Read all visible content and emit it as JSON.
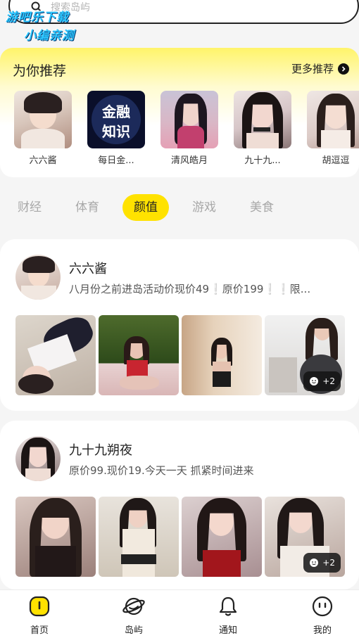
{
  "search": {
    "placeholder": "搜索岛屿"
  },
  "watermark": {
    "line1": "游吧乐下载",
    "line2": "小编亲测"
  },
  "recommend": {
    "title": "为你推荐",
    "more_label": "更多推荐",
    "items": [
      {
        "name": "六六酱"
      },
      {
        "name": "每日金...",
        "logo_text_1": "金融",
        "logo_text_2": "知识"
      },
      {
        "name": "清风皓月"
      },
      {
        "name": "九十九..."
      },
      {
        "name": "胡逗逗"
      }
    ]
  },
  "tabs": [
    {
      "label": "财经"
    },
    {
      "label": "体育"
    },
    {
      "label": "颜值",
      "active": true
    },
    {
      "label": "游戏"
    },
    {
      "label": "美食"
    }
  ],
  "posts": [
    {
      "author": "六六酱",
      "desc_part1": "八月份之前进岛活动价现价49",
      "desc_bang1": "❕",
      "desc_part2": "原价199",
      "desc_bang2": "❕❕",
      "desc_part3": "限...",
      "more_count": "+2"
    },
    {
      "author": "九十九朔夜",
      "desc": "原价99.现价19.今天一天 抓紧时间进来",
      "more_count": "+2"
    }
  ],
  "bottom_nav": [
    {
      "label": "首页",
      "icon": "home-icon",
      "active": true
    },
    {
      "label": "岛屿",
      "icon": "planet-icon"
    },
    {
      "label": "通知",
      "icon": "bell-icon"
    },
    {
      "label": "我的",
      "icon": "profile-face-icon"
    }
  ],
  "colors": {
    "accent": "#ffe200",
    "accent_light": "#fff46a",
    "inactive_tab": "#a8a8a8"
  }
}
